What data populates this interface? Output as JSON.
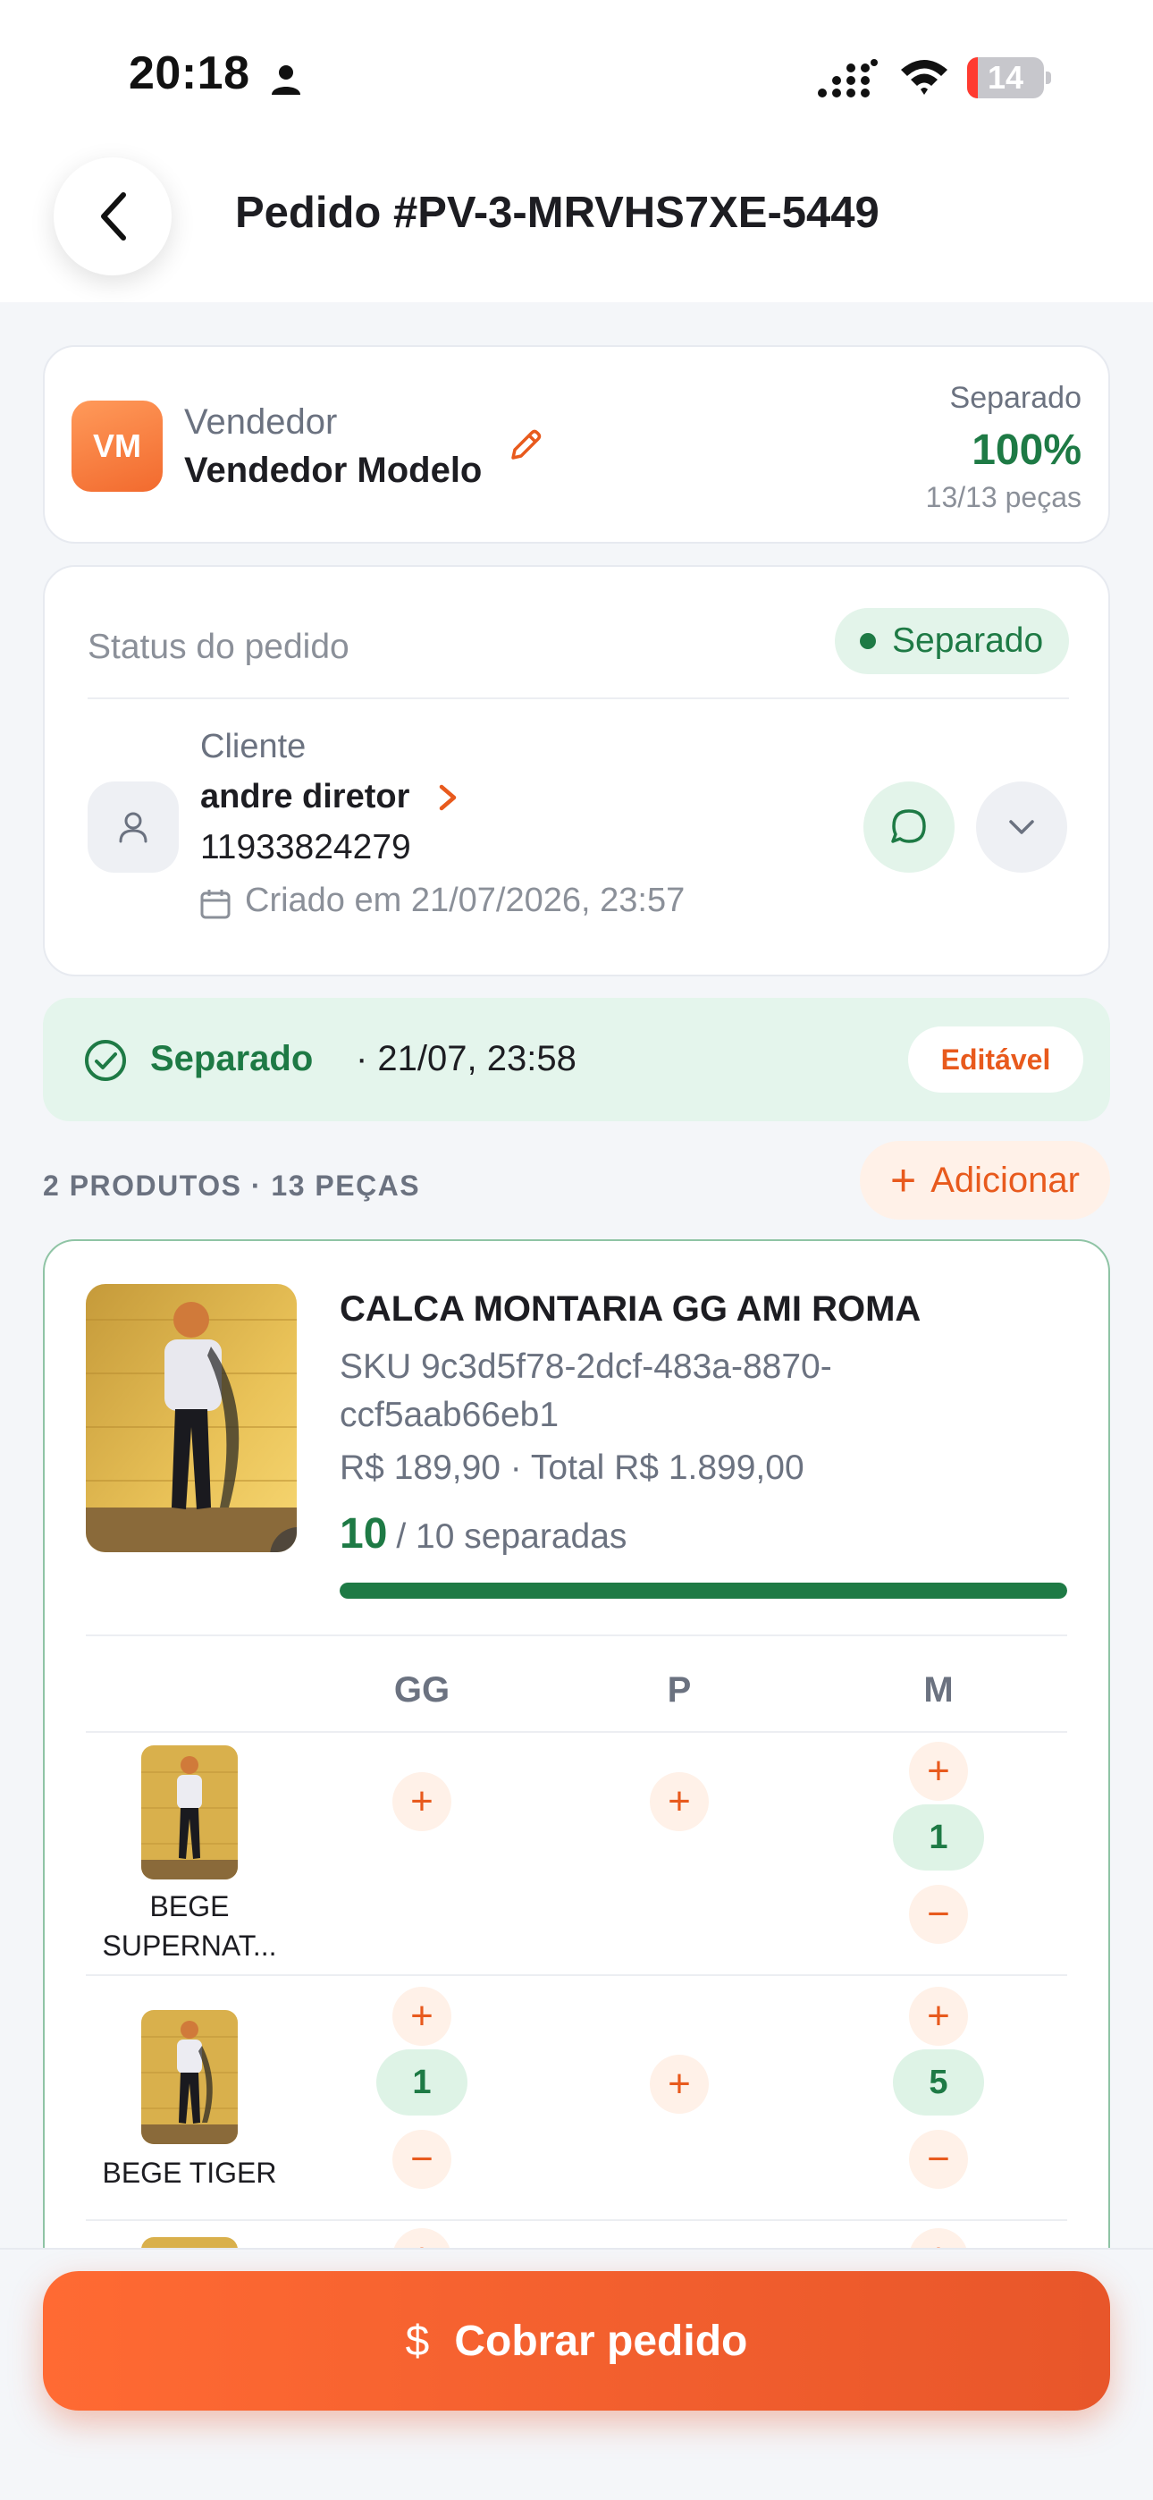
{
  "status_bar": {
    "time": "20:18",
    "battery": "14",
    "battery_level": 0.14
  },
  "header": {
    "title": "Pedido #PV-3-MRVHS7XE-5449"
  },
  "seller": {
    "initials": "VM",
    "label": "Vendedor",
    "name": "Vendedor Modelo",
    "status_label": "Separado",
    "percent": "100%",
    "count": "13/13 peças"
  },
  "order": {
    "status_label": "Status do pedido",
    "status_value": "Separado",
    "client_label": "Cliente",
    "client_name": "andre diretor",
    "client_phone": "11933824279",
    "created": "Criado em 21/07/2026, 23:57"
  },
  "banner": {
    "label": "Separado",
    "when": "· 21/07, 23:58",
    "badge": "Editável"
  },
  "products_summary": "2 PRODUTOS · 13 PEÇAS",
  "add_label": "Adicionar",
  "product": {
    "name": "CALCA MONTARIA GG AMI ROMA",
    "sku": "SKU 9c3d5f78-2dcf-483a-8870-ccf5aab66eb1",
    "price": "R$ 189,90 · Total R$ 1.899,00",
    "separated": "10",
    "separated_of": "/ 10 separadas",
    "progress": 1.0,
    "sizes": [
      "GG",
      "P",
      "M"
    ],
    "variants": [
      {
        "name": "BEGE SUPERNAT...",
        "counts": {
          "M": "1"
        }
      },
      {
        "name": "BEGE TIGER",
        "counts": {
          "GG": "1",
          "M": "5"
        }
      }
    ]
  },
  "cta": {
    "label": "Cobrar pedido",
    "icon": "$"
  },
  "colors": {
    "orange": "#e85a1d",
    "green": "#1e7a45",
    "green_bg": "#e3f4ea"
  }
}
